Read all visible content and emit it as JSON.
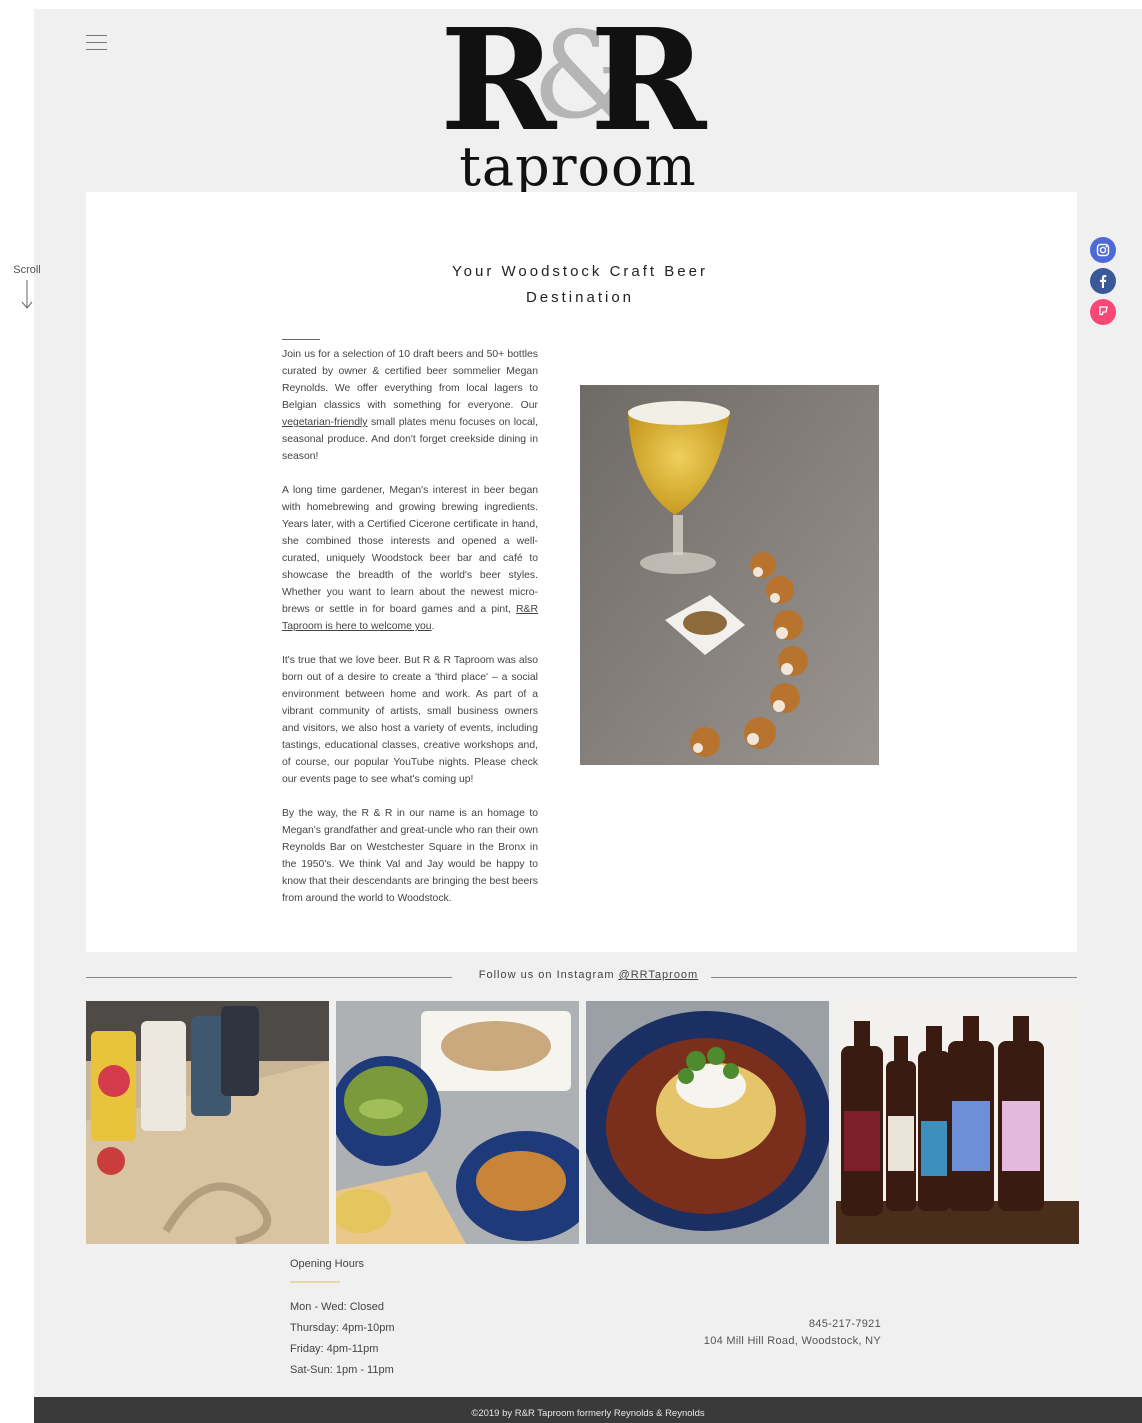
{
  "header": {
    "logo": {
      "letters_left": "R",
      "ampersand": "&",
      "letters_right": "R",
      "word": "taproom"
    }
  },
  "scroll_hint": "Scroll",
  "social": [
    {
      "name": "instagram-icon",
      "color": "#4f6ad6"
    },
    {
      "name": "facebook-icon",
      "color": "#3b5998"
    },
    {
      "name": "foursquare-icon",
      "color": "#f94877"
    }
  ],
  "main": {
    "headline_line1": "Your Woodstock Craft Beer",
    "headline_line2": "Destination",
    "paragraphs": {
      "p1_a": "Join us for a selection of 10 draft beers and 50+ bottles curated by owner & certified beer sommelier Megan Reynolds. We offer everything from local lagers to Belgian classics with something for everyone. Our ",
      "p1_link": "vegetarian-friendly",
      "p1_b": " small plates menu focuses on local, seasonal produce. And don't forget creekside dining in season!",
      "p2_a": "A long time gardener, Megan's interest in beer began with homebrewing and growing brewing ingredients. Years later, with a Certified Cicerone certificate in hand, she combined those interests and opened a well-curated, uniquely Woodstock beer bar and café to showcase the breadth of the world's beer styles. Whether you want to learn about the newest micro-brews or settle in for board games and a pint, ",
      "p2_link": "R&R Taproom is here to welcome you",
      "p2_b": ".",
      "p3": "It's true that we love beer. But R & R Taproom was also born out of a desire to create a 'third place' – a social environment between home and work. As part of a vibrant community of artists, small business owners and visitors, we also host a variety of events, including tastings, educational classes, creative workshops and, of course, our popular YouTube nights. Please check our events page to see what's coming up!",
      "p4": "By the way, the R & R in our name is an homage to Megan's grandfather and great-uncle who ran their own Reynolds Bar on Westchester Square in the Bronx in the 1950's. We think Val and Jay would be happy to know that their descendants are bringing the best beers from around the world to Woodstock."
    }
  },
  "instagram": {
    "label": "Follow us on Instagram ",
    "handle": "@RRTaproom"
  },
  "hours": {
    "title": "Opening Hours",
    "rows": [
      "Mon - Wed: Closed",
      "Thursday: 4pm-10pm",
      "Friday: 4pm-11pm",
      "Sat-Sun: 1pm - 11pm"
    ]
  },
  "contact": {
    "phone": "845-217-7921",
    "address": "104 Mill Hill Road, Woodstock, NY"
  },
  "footer": {
    "copyright": "©2019 by R&R Taproom formerly Reynolds & Reynolds"
  }
}
